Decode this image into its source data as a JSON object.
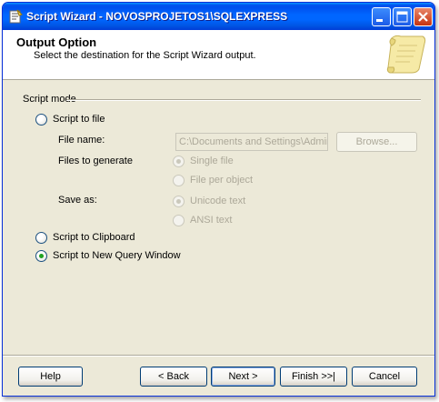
{
  "window": {
    "title": "Script Wizard - NOVOSPROJETOS1\\SQLEXPRESS",
    "minimize_icon": "minimize-icon",
    "maximize_icon": "maximize-icon",
    "close_icon": "close-icon",
    "app_icon": "script-wizard-icon"
  },
  "header": {
    "title": "Output Option",
    "subtitle": "Select the destination for the Script Wizard output.",
    "graphic_icon": "scroll-icon"
  },
  "script_mode": {
    "group_label": "Script mode",
    "options": [
      {
        "label": "Script to file",
        "checked": false,
        "enabled": true
      },
      {
        "label": "Script to Clipboard",
        "checked": false,
        "enabled": true
      },
      {
        "label": "Script to New Query Window",
        "checked": true,
        "enabled": true
      }
    ],
    "file_name_label": "File name:",
    "file_name_value": "C:\\Documents and Settings\\Admini",
    "browse_label": "Browse...",
    "files_to_generate_label": "Files to generate",
    "files_options": [
      {
        "label": "Single file",
        "checked": true,
        "enabled": false
      },
      {
        "label": "File per object",
        "checked": false,
        "enabled": false
      }
    ],
    "save_as_label": "Save as:",
    "save_as_options": [
      {
        "label": "Unicode text",
        "checked": true,
        "enabled": false
      },
      {
        "label": "ANSI text",
        "checked": false,
        "enabled": false
      }
    ]
  },
  "buttons": {
    "help": "Help",
    "back": "< Back",
    "next": "Next >",
    "finish": "Finish >>|",
    "cancel": "Cancel"
  }
}
